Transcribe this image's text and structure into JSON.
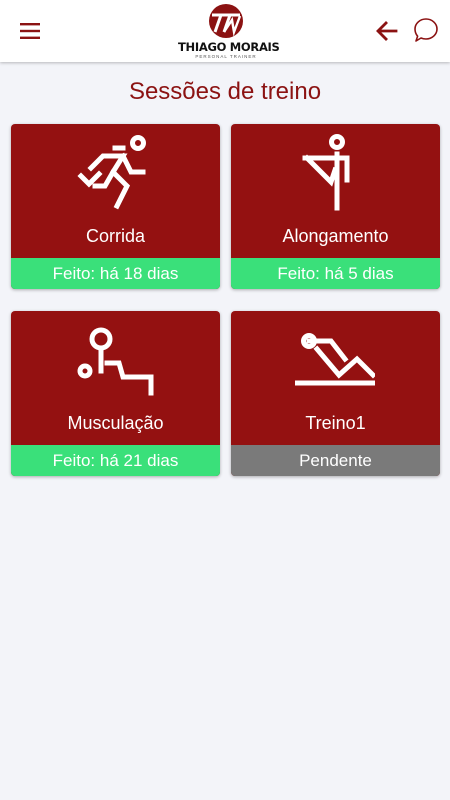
{
  "header": {
    "logo_text": "THIAGO MORAIS",
    "logo_subtitle": "PERSONAL TRAINER",
    "menu_icon": "hamburger-menu-icon",
    "back_icon": "arrow-left-icon",
    "chat_icon": "chat-bubble-icon"
  },
  "page": {
    "title": "Sessões de treino"
  },
  "sessions": [
    {
      "label": "Corrida",
      "status": "Feito: há 18 dias",
      "icon": "running-person-icon",
      "state": "done"
    },
    {
      "label": "Alongamento",
      "status": "Feito: há 5 dias",
      "icon": "stretching-person-icon",
      "state": "done"
    },
    {
      "label": "Musculação",
      "status": "Feito: há 21 dias",
      "icon": "weightlifting-person-icon",
      "state": "done"
    },
    {
      "label": "Treino1",
      "status": "Pendente",
      "icon": "floor-exercise-icon",
      "state": "pending"
    }
  ],
  "colors": {
    "primary": "#941111",
    "title": "#8b1212",
    "done": "#3ae07a",
    "pending": "#7a7a7a",
    "background": "#f3f4f9"
  }
}
